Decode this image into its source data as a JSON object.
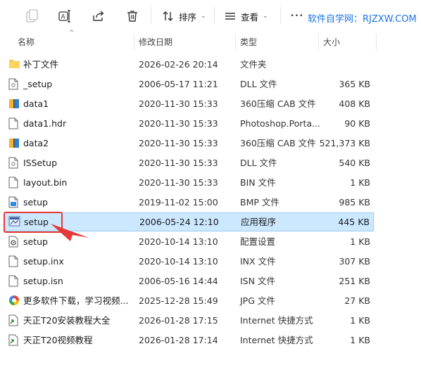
{
  "toolbar": {
    "sort_label": "排序",
    "view_label": "查看",
    "more_label": "•••",
    "brand_text": "软件自学网：RJZXW.COM"
  },
  "columns": {
    "name": "名称",
    "date": "修改日期",
    "type": "类型",
    "size": "大小"
  },
  "files": [
    {
      "name": "补丁文件",
      "date": "2026-02-26 20:14",
      "type": "文件夹",
      "size": "",
      "icon": "folder-icon"
    },
    {
      "name": "_setup",
      "date": "2006-05-17 11:21",
      "type": "DLL 文件",
      "size": "365 KB",
      "icon": "dll-file-icon"
    },
    {
      "name": "data1",
      "date": "2020-11-30 15:33",
      "type": "360压缩 CAB 文件",
      "size": "408 KB",
      "icon": "cab-archive-icon"
    },
    {
      "name": "data1.hdr",
      "date": "2020-11-30 15:33",
      "type": "Photoshop.Porta...",
      "size": "90 KB",
      "icon": "blank-file-icon"
    },
    {
      "name": "data2",
      "date": "2020-11-30 15:33",
      "type": "360压缩 CAB 文件",
      "size": "521,373 KB",
      "icon": "cab-archive-icon"
    },
    {
      "name": "ISSetup",
      "date": "2020-11-30 15:33",
      "type": "DLL 文件",
      "size": "540 KB",
      "icon": "dll-file-icon"
    },
    {
      "name": "layout.bin",
      "date": "2020-11-30 15:33",
      "type": "BIN 文件",
      "size": "1 KB",
      "icon": "blank-file-icon"
    },
    {
      "name": "setup",
      "date": "2019-11-02 15:00",
      "type": "BMP 文件",
      "size": "985 KB",
      "icon": "bmp-image-icon"
    },
    {
      "name": "setup",
      "date": "2006-05-24 12:10",
      "type": "应用程序",
      "size": "445 KB",
      "icon": "setup-exe-icon",
      "selected": true
    },
    {
      "name": "setup",
      "date": "2020-10-14 13:10",
      "type": "配置设置",
      "size": "1 KB",
      "icon": "config-settings-icon"
    },
    {
      "name": "setup.inx",
      "date": "2020-10-14 13:10",
      "type": "INX 文件",
      "size": "307 KB",
      "icon": "blank-file-icon"
    },
    {
      "name": "setup.isn",
      "date": "2006-05-16 14:44",
      "type": "ISN 文件",
      "size": "251 KB",
      "icon": "blank-file-icon"
    },
    {
      "name": "更多软件下载，学习视频...",
      "date": "2025-12-28 15:49",
      "type": "JPG 文件",
      "size": "27 KB",
      "icon": "jpg-image-icon"
    },
    {
      "name": "天正T20安装教程大全",
      "date": "2026-01-28 17:15",
      "type": "Internet 快捷方式",
      "size": "1 KB",
      "icon": "internet-shortcut-icon"
    },
    {
      "name": "天正T20视频教程",
      "date": "2026-01-28 17:14",
      "type": "Internet 快捷方式",
      "size": "1 KB",
      "icon": "internet-shortcut-icon"
    }
  ],
  "colors": {
    "selected_bg": "#cce8ff",
    "selected_border": "#99c9ef",
    "annotation": "#e53935",
    "brand": "#1a73e8"
  }
}
